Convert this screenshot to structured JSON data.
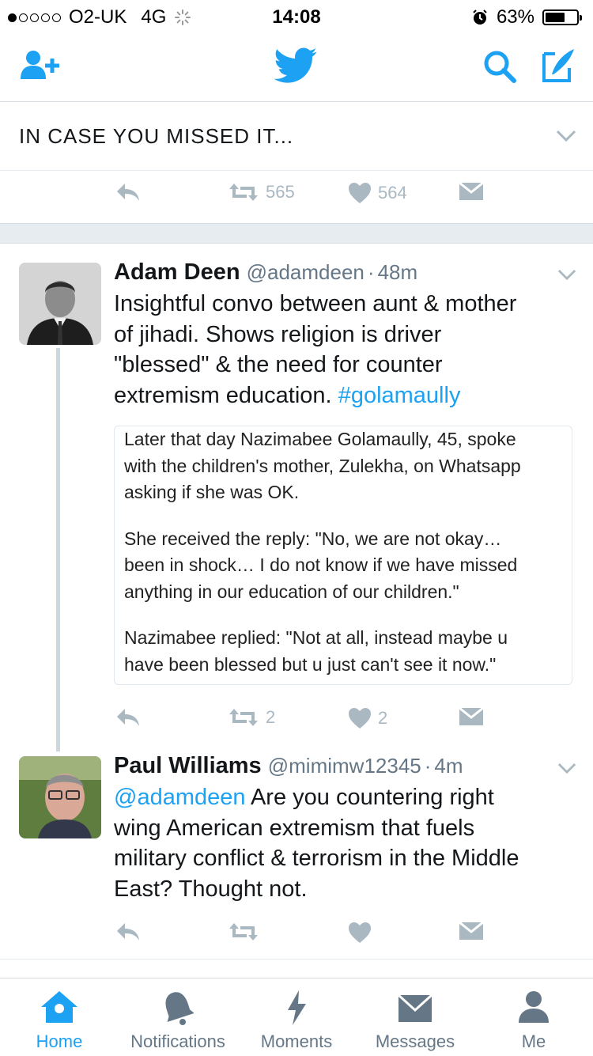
{
  "status_bar": {
    "carrier": "O2-UK",
    "network": "4G",
    "time": "14:08",
    "battery": "63%",
    "battery_level": 0.63
  },
  "nav": {
    "icons": [
      "add-user-icon",
      "twitter-bird-icon",
      "search-icon",
      "compose-icon"
    ]
  },
  "section": {
    "title": "IN CASE YOU MISSED IT..."
  },
  "prev_tweet_actions": {
    "retweets": "565",
    "likes": "564"
  },
  "tweets": [
    {
      "name": "Adam Deen",
      "handle": "@adamdeen",
      "sep": "·",
      "time": "48m",
      "text_lines": [
        "Insightful convo between aunt & mother",
        "of jihadi. Shows religion is driver",
        "\"blessed\" & the need for counter",
        "extremism education."
      ],
      "hashtag": "#golamaully",
      "quote": {
        "p1": [
          "Later that day Nazimabee Golamaully, 45, spoke",
          "with the children's mother, Zulekha, on Whatsapp",
          "asking if she was OK."
        ],
        "p2": [
          "She received the reply: \"No, we are not okay…",
          "been in shock… I do not know if we have missed",
          "anything in our education of our children.\""
        ],
        "p3": [
          "Nazimabee replied: \"Not at all, instead maybe u",
          "have been blessed but u just can't see it now.\""
        ]
      },
      "retweets": "2",
      "likes": "2"
    },
    {
      "name": "Paul Williams",
      "handle": "@mimimw12345",
      "sep": "·",
      "time": "4m",
      "mention": "@adamdeen",
      "text_first": " Are you countering right",
      "text_lines": [
        "wing American extremism that fuels",
        "military conflict & terrorism in the Middle",
        "East? Thought not."
      ]
    }
  ],
  "tabs": [
    {
      "label": "Home",
      "icon": "home-icon",
      "active": true
    },
    {
      "label": "Notifications",
      "icon": "bell-icon"
    },
    {
      "label": "Moments",
      "icon": "lightning-icon"
    },
    {
      "label": "Messages",
      "icon": "envelope-icon"
    },
    {
      "label": "Me",
      "icon": "person-icon"
    }
  ],
  "colors": {
    "accent": "#1da1f2",
    "muted": "#aab8c2",
    "text": "#14171a"
  }
}
